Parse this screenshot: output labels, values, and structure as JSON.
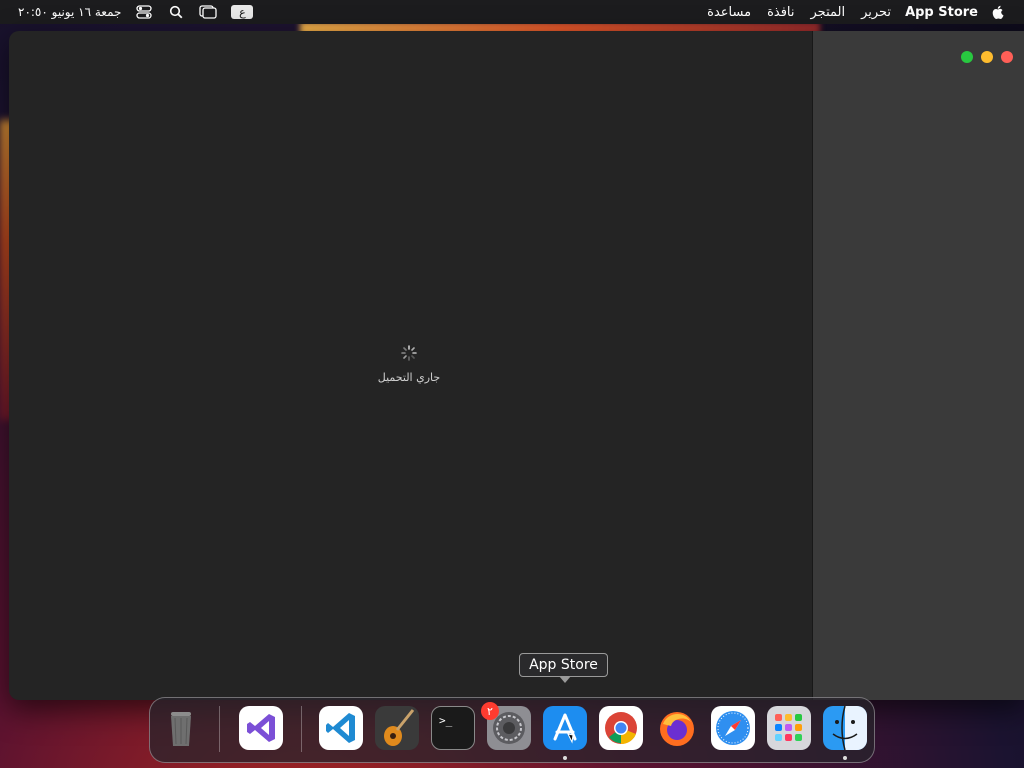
{
  "menubar": {
    "app_name": "App Store",
    "items": [
      "تحرير",
      "المتجر",
      "نافذة",
      "مساعدة"
    ],
    "input_source": "ع",
    "clock": "جمعة ١٦ يونيو ٢٠:٥٠"
  },
  "window": {
    "loading_text": "جاري التحميل"
  },
  "tooltip": {
    "text": "App Store"
  },
  "dock": {
    "badge_count": "٢",
    "accent_colors": {
      "close": "#ff5f57",
      "minimize": "#febc2e",
      "maximize": "#28c840",
      "badge": "#ff3b30"
    }
  }
}
